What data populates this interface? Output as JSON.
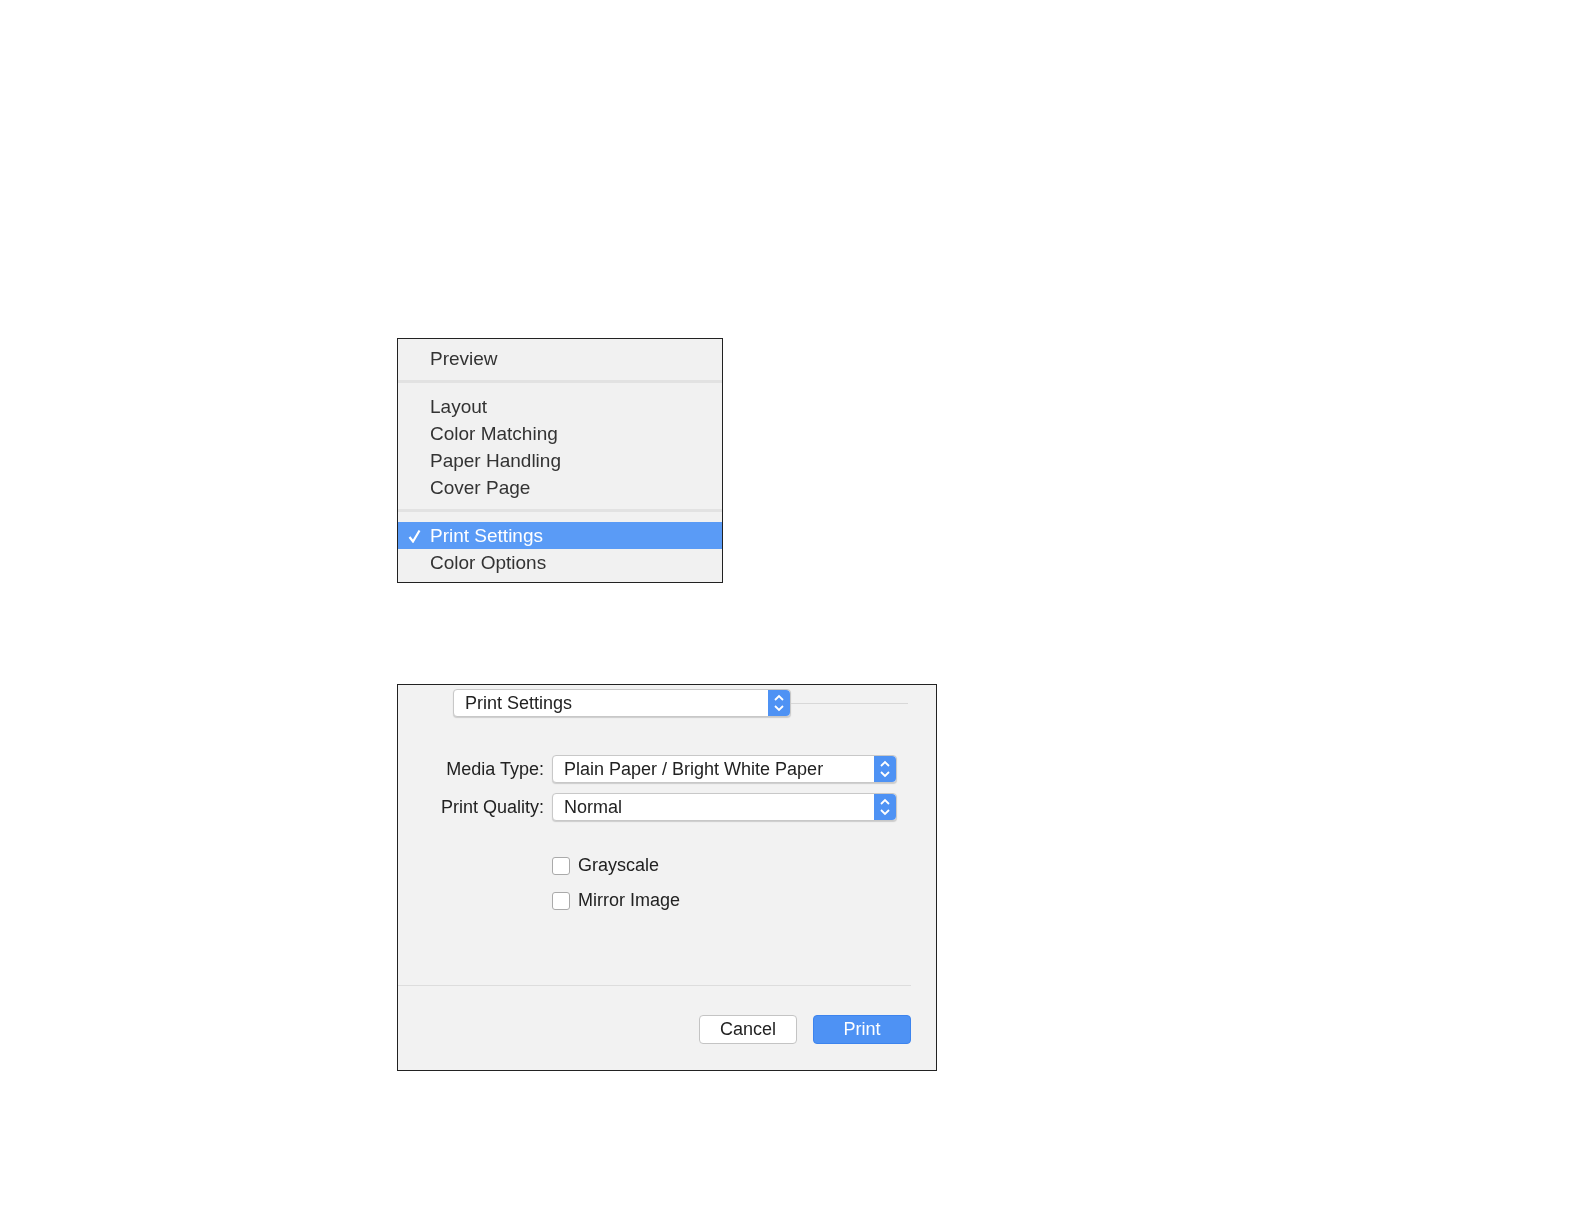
{
  "menu": {
    "sections": [
      {
        "items": [
          {
            "label": "Preview",
            "checked": false,
            "selected": false
          }
        ]
      },
      {
        "items": [
          {
            "label": "Layout",
            "checked": false,
            "selected": false
          },
          {
            "label": "Color Matching",
            "checked": false,
            "selected": false
          },
          {
            "label": "Paper Handling",
            "checked": false,
            "selected": false
          },
          {
            "label": "Cover Page",
            "checked": false,
            "selected": false
          }
        ]
      },
      {
        "items": [
          {
            "label": "Print Settings",
            "checked": true,
            "selected": true
          },
          {
            "label": "Color Options",
            "checked": false,
            "selected": false
          }
        ]
      }
    ]
  },
  "dialog": {
    "panel_popup": "Print Settings",
    "fields": [
      {
        "label": "Media Type:",
        "value": "Plain Paper / Bright White Paper"
      },
      {
        "label": "Print Quality:",
        "value": "Normal"
      }
    ],
    "checkboxes": [
      {
        "label": "Grayscale",
        "checked": false
      },
      {
        "label": "Mirror Image",
        "checked": false
      }
    ],
    "buttons": [
      {
        "label": "Cancel",
        "kind": "secondary"
      },
      {
        "label": "Print",
        "kind": "primary"
      }
    ]
  }
}
